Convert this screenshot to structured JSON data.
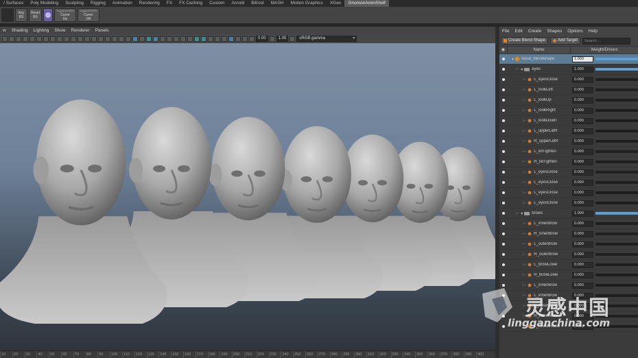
{
  "shelf_tabs": [
    "/ Surfaces",
    "Poly Modeling",
    "Sculpting",
    "Rigging",
    "Animation",
    "Rendering",
    "FX",
    "FX Caching",
    "Custom",
    "Arnold",
    "Bifrost",
    "MASH",
    "Motion Graphics",
    "XGen",
    "GnomonAnimShelf"
  ],
  "shelf_tabs_active": "GnomonAnimShelf",
  "shelf_buttons": [
    {
      "top": "Key",
      "bottom": "BS"
    },
    {
      "top": "Reset",
      "bottom": "BS"
    },
    {
      "top": "Curve",
      "bottom": "On",
      "sub": "ToggleNURBS"
    },
    {
      "top": "Curve",
      "bottom": "Off",
      "sub": "ToggleNURBS"
    }
  ],
  "viewport_menu": [
    "w",
    "Shading",
    "Lighting",
    "Show",
    "Renderer",
    "Panels"
  ],
  "viewport_tools": {
    "exposure": "0.00",
    "gamma": "1.00",
    "color_space": "sRGB gamma"
  },
  "timeline_ticks": [
    "10",
    "20",
    "30",
    "40",
    "50",
    "60",
    "70",
    "80",
    "90",
    "100",
    "110",
    "120",
    "130",
    "140",
    "150",
    "160",
    "170",
    "180",
    "190",
    "200",
    "210",
    "220",
    "230",
    "240",
    "250",
    "260",
    "270",
    "280",
    "290",
    "300",
    "310",
    "320",
    "330",
    "340",
    "350",
    "360",
    "370",
    "380",
    "390",
    "400"
  ],
  "shape_editor": {
    "menu": [
      "File",
      "Edit",
      "Create",
      "Shapes",
      "Options",
      "Help"
    ],
    "create_blend_shape": "Create Blend Shape",
    "add_target": "Add Target",
    "search_placeholder": "Search...",
    "col_name": "Name",
    "col_weight": "Weight/Drivers",
    "rows": [
      {
        "type": "blendshape",
        "name": "facial_blendshape",
        "value": "1.000",
        "selected": true
      },
      {
        "type": "group",
        "name": "eyes",
        "value": "1.000"
      },
      {
        "type": "target",
        "name": "L_eyesClose",
        "value": "0.000"
      },
      {
        "type": "target",
        "name": "L_lookLeft",
        "value": "0.000"
      },
      {
        "type": "target",
        "name": "L_lookUp",
        "value": "0.000"
      },
      {
        "type": "target",
        "name": "L_lookRight",
        "value": "0.000"
      },
      {
        "type": "target",
        "name": "L_lookDown",
        "value": "0.000"
      },
      {
        "type": "target",
        "name": "L_upperLidR",
        "value": "0.000"
      },
      {
        "type": "target",
        "name": "R_upperLidR",
        "value": "0.000"
      },
      {
        "type": "target",
        "name": "L_lidTighten",
        "value": "0.000"
      },
      {
        "type": "target",
        "name": "R_lidTighten",
        "value": "0.000"
      },
      {
        "type": "target",
        "name": "L_eyesClose",
        "value": "0.000"
      },
      {
        "type": "target",
        "name": "L_eyesClose",
        "value": "0.000"
      },
      {
        "type": "target",
        "name": "L_eyesClose",
        "value": "0.000"
      },
      {
        "type": "target",
        "name": "L_eyesClose",
        "value": "0.000"
      },
      {
        "type": "group",
        "name": "brows",
        "value": "1.000"
      },
      {
        "type": "target",
        "name": "L_innerBrow",
        "value": "0.000"
      },
      {
        "type": "target",
        "name": "R_innerBrow",
        "value": "0.000"
      },
      {
        "type": "target",
        "name": "L_outerBrow",
        "value": "0.000"
      },
      {
        "type": "target",
        "name": "R_outerBrow",
        "value": "0.000"
      },
      {
        "type": "target",
        "name": "L_browLowe",
        "value": "0.000"
      },
      {
        "type": "target",
        "name": "R_browLowe",
        "value": "0.000"
      },
      {
        "type": "target",
        "name": "L_innerBrow",
        "value": "0.000"
      },
      {
        "type": "target",
        "name": "L_innerBrow",
        "value": "0.000"
      },
      {
        "type": "target",
        "name": "L_noseWrinkl",
        "value": "0.000"
      },
      {
        "type": "target",
        "name": "R_noseWrin",
        "value": "0.000"
      },
      {
        "type": "target",
        "name": "L_cheekRaise",
        "value": "0.000"
      }
    ]
  },
  "watermark": {
    "cn": "灵感中国",
    "url": "lingganchina.com"
  }
}
